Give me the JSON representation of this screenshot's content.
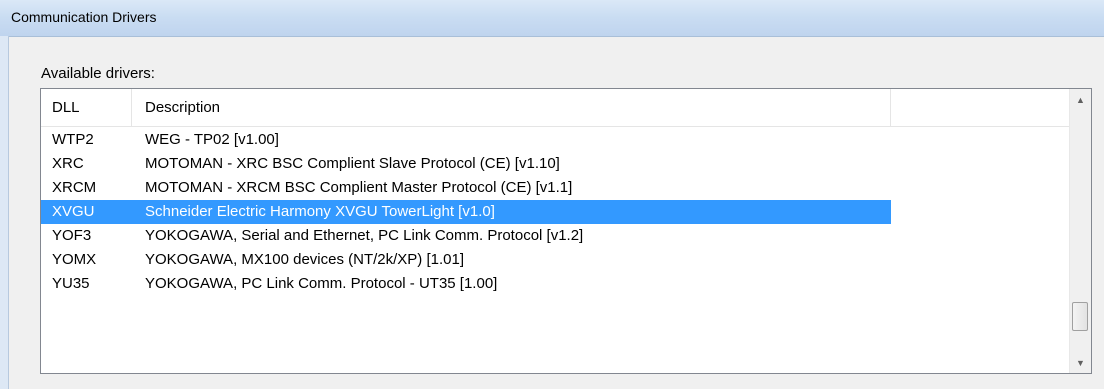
{
  "window": {
    "title": "Communication Drivers"
  },
  "section_label": "Available drivers:",
  "columns": {
    "dll": "DLL",
    "description": "Description",
    "extra": ""
  },
  "rows": [
    {
      "dll": "WTP2",
      "description": "WEG - TP02  [v1.00]",
      "selected": false
    },
    {
      "dll": "XRC",
      "description": "MOTOMAN - XRC BSC Complient Slave Protocol (CE) [v1.10]",
      "selected": false
    },
    {
      "dll": "XRCM",
      "description": "MOTOMAN - XRCM BSC Complient Master Protocol (CE) [v1.1]",
      "selected": false
    },
    {
      "dll": "XVGU",
      "description": "Schneider Electric Harmony XVGU TowerLight [v1.0]",
      "selected": true
    },
    {
      "dll": "YOF3",
      "description": "YOKOGAWA, Serial and Ethernet, PC Link Comm. Protocol  [v1.2]",
      "selected": false
    },
    {
      "dll": "YOMX",
      "description": "YOKOGAWA, MX100 devices (NT/2k/XP) [1.01]",
      "selected": false
    },
    {
      "dll": "YU35",
      "description": "YOKOGAWA, PC Link Comm. Protocol - UT35  [1.00]",
      "selected": false
    }
  ],
  "scrollbar": {
    "up_icon": "scroll-up-arrow-icon",
    "down_icon": "scroll-down-arrow-icon",
    "position": 0.9
  },
  "colors": {
    "selection": "#3399ff",
    "titlebar": "#c9dcf2"
  }
}
